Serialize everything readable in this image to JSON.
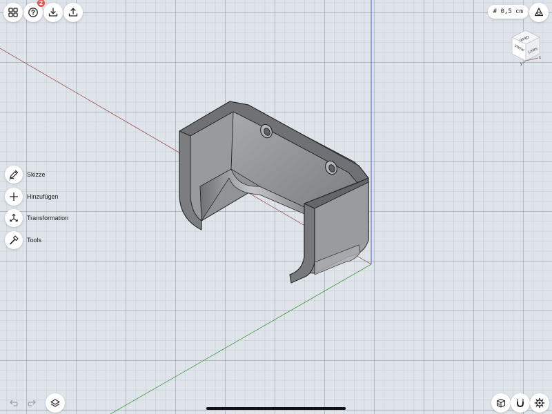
{
  "toolbar": {
    "help_badge": "2",
    "grid_size": "# 0,5 cm"
  },
  "tools": [
    {
      "label": "Skizze",
      "icon": "pen-icon"
    },
    {
      "label": "Hinzufügen",
      "icon": "plus-icon"
    },
    {
      "label": "Transformation",
      "icon": "transform-icon"
    },
    {
      "label": "Tools",
      "icon": "hammer-icon"
    }
  ],
  "view_cube": {
    "top": "Oben",
    "front": "Vorne",
    "right": "Links",
    "axis_x": "x",
    "axis_y": "y"
  },
  "colors": {
    "x_axis": "#a0525c",
    "y_axis": "#3f9a3f",
    "z_axis": "#5b5bd6",
    "model_fill": "#8f9194",
    "model_edge": "#2a2a2a"
  }
}
